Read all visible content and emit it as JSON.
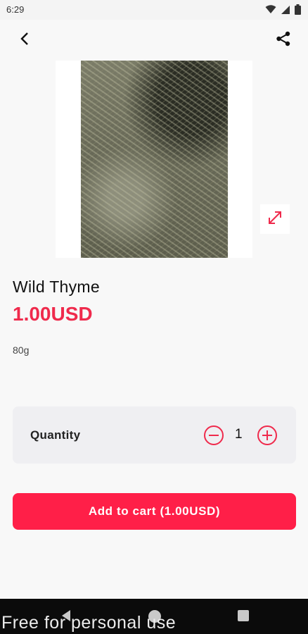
{
  "status_bar": {
    "time": "6:29"
  },
  "product": {
    "name": "Wild Thyme",
    "price": "1.00USD",
    "weight": "80g"
  },
  "quantity": {
    "label": "Quantity",
    "value": "1"
  },
  "cart": {
    "button_label": "Add to cart (1.00USD)"
  },
  "watermark": "Free for personal use",
  "colors": {
    "accent": "#ff1f48",
    "price": "#ef2a4c"
  }
}
